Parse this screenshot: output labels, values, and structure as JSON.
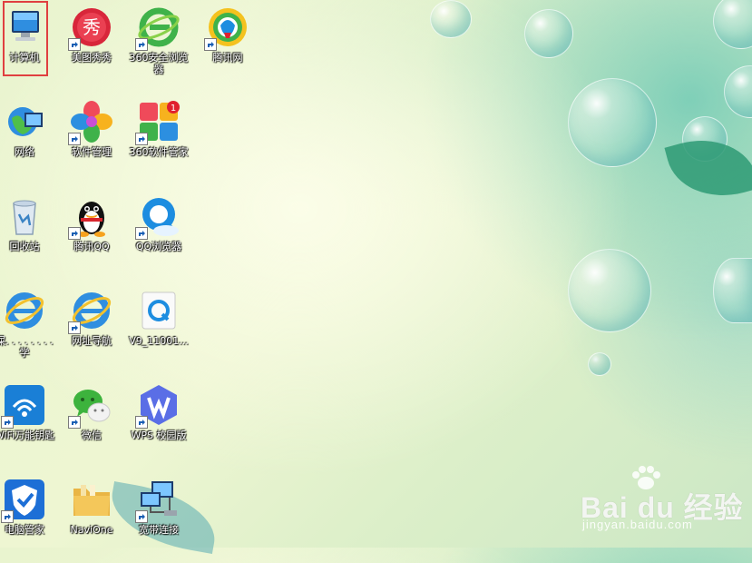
{
  "desktop": {
    "icons": [
      {
        "label": "计算机",
        "icon": "computer-icon"
      },
      {
        "label": "美图秀秀",
        "icon": "meitu-icon"
      },
      {
        "label": "360安全浏览器",
        "icon": "360-browser-icon"
      },
      {
        "label": "腾讯网",
        "icon": "tencent-news-icon"
      },
      {
        "label": "网络",
        "icon": "network-icon"
      },
      {
        "label": "软件管理",
        "icon": "software-manager-icon"
      },
      {
        "label": "360软件管家",
        "icon": "360-software-icon"
      },
      {
        "label": "回收站",
        "icon": "recycle-bin-icon"
      },
      {
        "label": "腾讯QQ",
        "icon": "qq-icon"
      },
      {
        "label": "QQ浏览器",
        "icon": "qq-browser-icon"
      },
      {
        "label": "屎. . . . . . . . 学",
        "icon": "ie-icon"
      },
      {
        "label": "网址导航",
        "icon": "ie-nav-icon"
      },
      {
        "label": "V9_11001...",
        "icon": "qq-browser-installer-icon"
      },
      {
        "label": "WiFi万能钥匙",
        "icon": "wifi-key-icon"
      },
      {
        "label": "微信",
        "icon": "wechat-icon"
      },
      {
        "label": "WPS 校园版",
        "icon": "wps-icon"
      },
      {
        "label": "电脑管家",
        "icon": "pc-manager-icon"
      },
      {
        "label": "NaviOne",
        "icon": "folder-icon"
      },
      {
        "label": "宽带连接",
        "icon": "broadband-icon"
      }
    ],
    "badge_360_software": "1"
  },
  "watermark": {
    "brand": "Bai du 经验",
    "url": "jingyan.baidu.com"
  },
  "colors": {
    "selection_border": "#e04040",
    "label_text": "#ffffff"
  }
}
